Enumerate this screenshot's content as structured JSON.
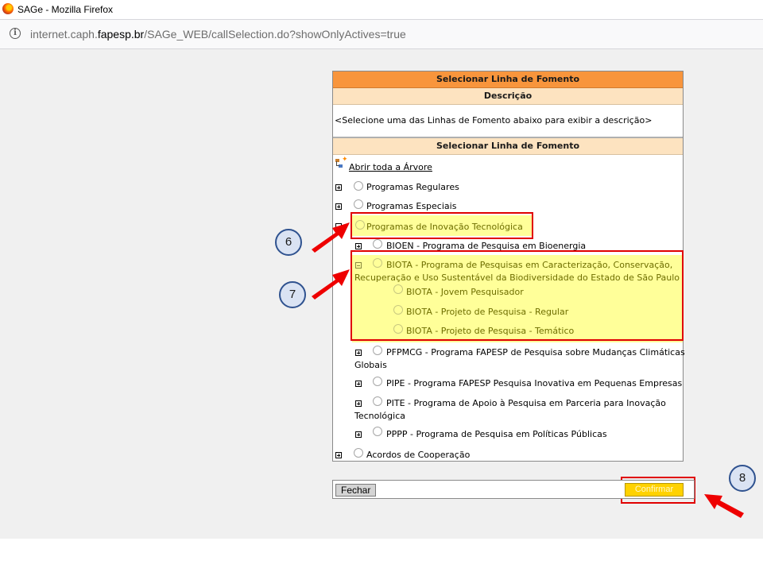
{
  "window": {
    "title": "SAGe - Mozilla Firefox"
  },
  "urlbar": {
    "prefix": "internet.caph.",
    "domain": "fapesp.br",
    "path": "/SAGe_WEB/callSelection.do?showOnlyActives=true"
  },
  "dialog": {
    "title": "Selecionar Linha de Fomento",
    "description_header": "Descrição",
    "description_text": "<Selecione uma das Linhas de Fomento abaixo para exibir a descrição>",
    "tree_header": "Selecionar Linha de Fomento",
    "open_all": "Abrir toda a Árvore",
    "items": {
      "regulares": "Programas Regulares",
      "especiais": "Programas Especiais",
      "inovacao": "Programas de Inovação Tecnológica",
      "bioen": "BIOEN - Programa de Pesquisa em Bioenergia",
      "biota_line1": "BIOTA - Programa de Pesquisas em Caracterização, Conservação,",
      "biota_line2": "Recuperação e Uso Sustentável da Biodiversidade do Estado de São Paulo",
      "biota_jovem": "BIOTA - Jovem Pesquisador",
      "biota_regular": "BIOTA - Projeto de Pesquisa - Regular",
      "biota_tematico": "BIOTA - Projeto de Pesquisa - Temático",
      "pfpmcg_line1": "PFPMCG - Programa FAPESP de Pesquisa sobre Mudanças Climáticas",
      "pfpmcg_line2": "Globais",
      "pipe": "PIPE - Programa FAPESP Pesquisa Inovativa em Pequenas Empresas",
      "pite_line1": "PITE - Programa de Apoio à Pesquisa em Parceria para Inovação",
      "pite_line2": "Tecnológica",
      "pppp": "PPPP - Programa de Pesquisa em Políticas Públicas",
      "acordos": "Acordos de Cooperação"
    }
  },
  "buttons": {
    "close": "Fechar",
    "confirm": "Confirmar"
  },
  "callouts": {
    "six": "6",
    "seven": "7",
    "eight": "8"
  },
  "colors": {
    "header_orange": "#f8953c",
    "header_beige": "#fde3c0",
    "highlight_yellow": "#ffff99",
    "annotation_red": "#e00000",
    "confirm_yellow": "#ffd200"
  },
  "icons": [
    "firefox-logo",
    "info-icon",
    "tree-icon",
    "expand-icon",
    "collapse-icon",
    "radio-icon",
    "arrow-icon"
  ]
}
